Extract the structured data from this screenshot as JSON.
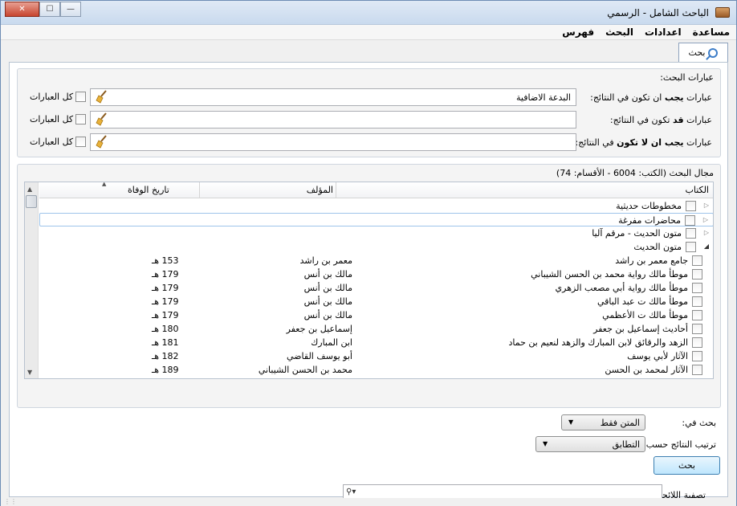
{
  "window": {
    "title": "الباحث الشامل - الرسمي"
  },
  "menu": [
    "فهرس",
    "البحث",
    "اعدادات",
    "مساعدة"
  ],
  "tab": {
    "label": "بحث"
  },
  "search_group": {
    "title": "عبارات البحث:",
    "rows": [
      {
        "label_pre": "عبارات ",
        "label_bold": "يجب",
        "label_post": " ان تكون في النتائج:",
        "value": "البدعة الاضافية",
        "all_label": "كل العبارات"
      },
      {
        "label_pre": "عبارات ",
        "label_bold": "قد",
        "label_post": " تكون في النتائج:",
        "value": "",
        "all_label": "كل العبارات"
      },
      {
        "label_pre": "عبارات ",
        "label_bold": "يجب ان لا تكون",
        "label_post": " في النتائج:",
        "value": "",
        "all_label": "كل العبارات"
      }
    ]
  },
  "scope_group": {
    "title": "مجال البحث (الكتب: 6004 - الأقسام: 74)",
    "columns": {
      "book": "الكتاب",
      "author": "المؤلف",
      "death": "تاريخ الوفاة"
    },
    "categories": [
      {
        "name": "مخطوطات حديثية",
        "expanded": false
      },
      {
        "name": "محاضرات مفرغة",
        "expanded": false
      },
      {
        "name": "متون الحديث - مرقم آليا",
        "expanded": false
      },
      {
        "name": "متون الحديث",
        "expanded": true
      }
    ],
    "books": [
      {
        "name": "جامع معمر بن راشد",
        "author": "معمر بن راشد",
        "death": "153 هـ"
      },
      {
        "name": "موطأ مالك رواية محمد بن الحسن الشيباني",
        "author": "مالك بن أنس",
        "death": "179 هـ"
      },
      {
        "name": "موطأ مالك رواية أبي مصعب الزهري",
        "author": "مالك بن أنس",
        "death": "179 هـ"
      },
      {
        "name": "موطأ مالك ت عبد الباقي",
        "author": "مالك بن أنس",
        "death": "179 هـ"
      },
      {
        "name": "موطأ مالك ت الأعظمي",
        "author": "مالك بن أنس",
        "death": "179 هـ"
      },
      {
        "name": "أحاديث إسماعيل بن جعفر",
        "author": "إسماعيل بن جعفر",
        "death": "180 هـ"
      },
      {
        "name": "الزهد والرقائق لابن المبارك والزهد لنعيم بن حماد",
        "author": "ابن المبارك",
        "death": "181 هـ"
      },
      {
        "name": "الآثار لأبي يوسف",
        "author": "أبو يوسف القاضي",
        "death": "182 هـ"
      },
      {
        "name": "الآثار لمحمد بن الحسن",
        "author": "محمد بن الحسن الشيباني",
        "death": "189 هـ"
      }
    ],
    "filter_label": "تصفية اللائحة:"
  },
  "options": {
    "search_in_label": "بحث في:",
    "search_in_value": "المتن فقط",
    "sort_label": "ترتيب النتائج حسب:",
    "sort_value": "التطابق",
    "submit": "بحث"
  }
}
